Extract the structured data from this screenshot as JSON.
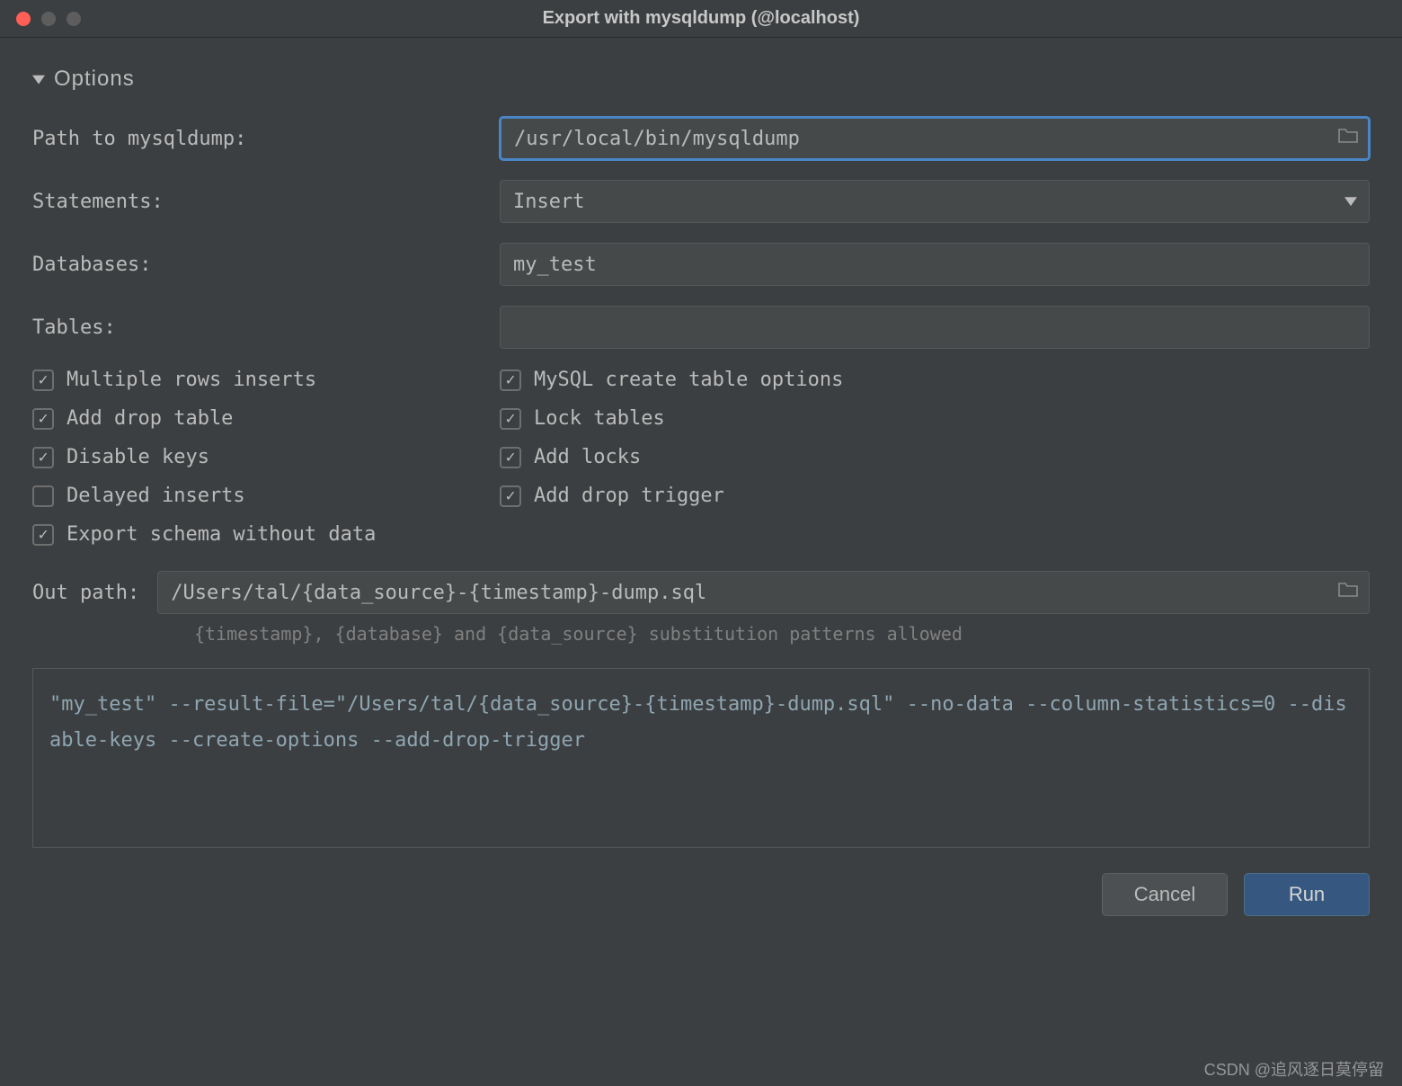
{
  "window": {
    "title": "Export with mysqldump (@localhost)"
  },
  "section": {
    "title": "Options"
  },
  "fields": {
    "path_label": "Path to mysqldump:",
    "path_value": "/usr/local/bin/mysqldump",
    "statements_label": "Statements:",
    "statements_value": "Insert",
    "databases_label": "Databases:",
    "databases_value": "my_test",
    "tables_label": "Tables:",
    "tables_value": ""
  },
  "checkboxes": {
    "multiple_rows": {
      "label": "Multiple rows inserts",
      "checked": true
    },
    "mysql_create": {
      "label": "MySQL create table options",
      "checked": true
    },
    "add_drop_table": {
      "label": "Add drop table",
      "checked": true
    },
    "lock_tables": {
      "label": "Lock tables",
      "checked": true
    },
    "disable_keys": {
      "label": "Disable keys",
      "checked": true
    },
    "add_locks": {
      "label": "Add locks",
      "checked": true
    },
    "delayed_inserts": {
      "label": "Delayed inserts",
      "checked": false
    },
    "add_drop_trigger": {
      "label": "Add drop trigger",
      "checked": true
    },
    "export_schema": {
      "label": "Export schema without data",
      "checked": true
    }
  },
  "outpath": {
    "label": "Out path:",
    "value": "/Users/tal/{data_source}-{timestamp}-dump.sql",
    "hint": "{timestamp}, {database} and {data_source} substitution patterns allowed"
  },
  "preview": "\"my_test\" --result-file=\"/Users/tal/{data_source}-{timestamp}-dump.sql\" --no-data --column-statistics=0 --disable-keys --create-options --add-drop-trigger",
  "buttons": {
    "cancel": "Cancel",
    "run": "Run"
  },
  "watermark": "CSDN @追风逐日莫停留"
}
